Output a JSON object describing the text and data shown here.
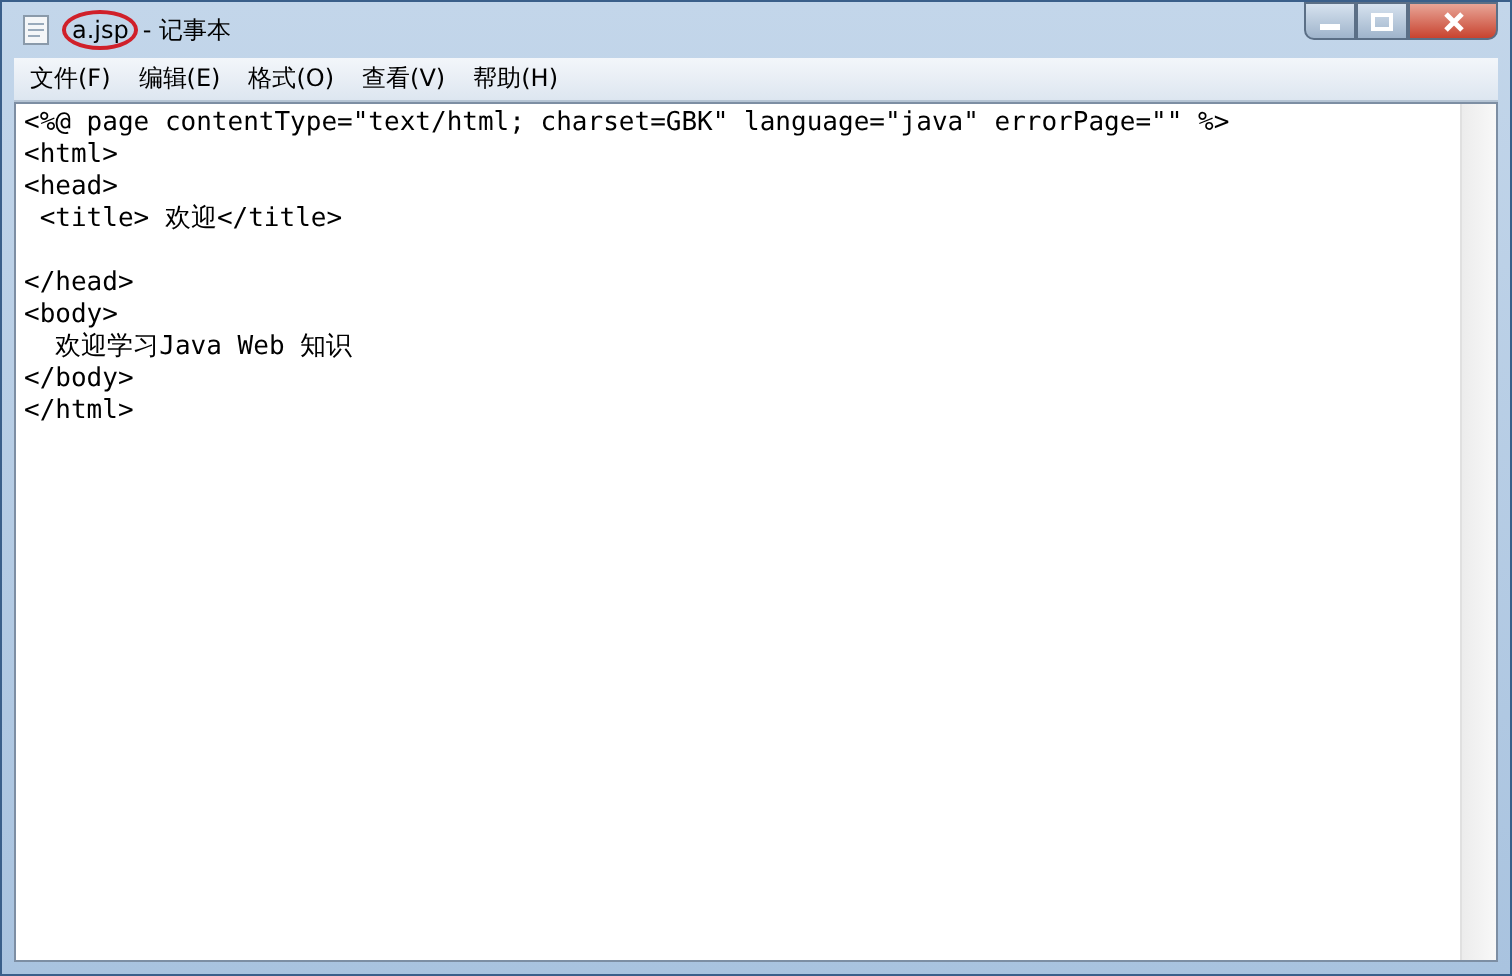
{
  "window": {
    "title_file": "a.jsp",
    "title_app": "- 记事本",
    "file_circled": true
  },
  "menu": [
    "文件(F)",
    "编辑(E)",
    "格式(O)",
    "查看(V)",
    "帮助(H)"
  ],
  "editor": {
    "lines": [
      {
        "text": "<%@ page contentType=\"text/html; charset=GBK\" language=\"java\" errorPage=\"\" %>",
        "blank_before": false
      },
      {
        "text": "<html>",
        "blank_before": false
      },
      {
        "text": "<head>",
        "blank_before": false
      },
      {
        "text": " <title> 欢迎</title>",
        "blank_before": false
      },
      {
        "text": "</head>",
        "blank_before": true
      },
      {
        "text": "<body>",
        "blank_before": false
      },
      {
        "text": "  欢迎学习Java Web 知识",
        "blank_before": false
      },
      {
        "text": "</body>",
        "blank_before": false
      },
      {
        "text": "</html>",
        "blank_before": false
      }
    ]
  }
}
